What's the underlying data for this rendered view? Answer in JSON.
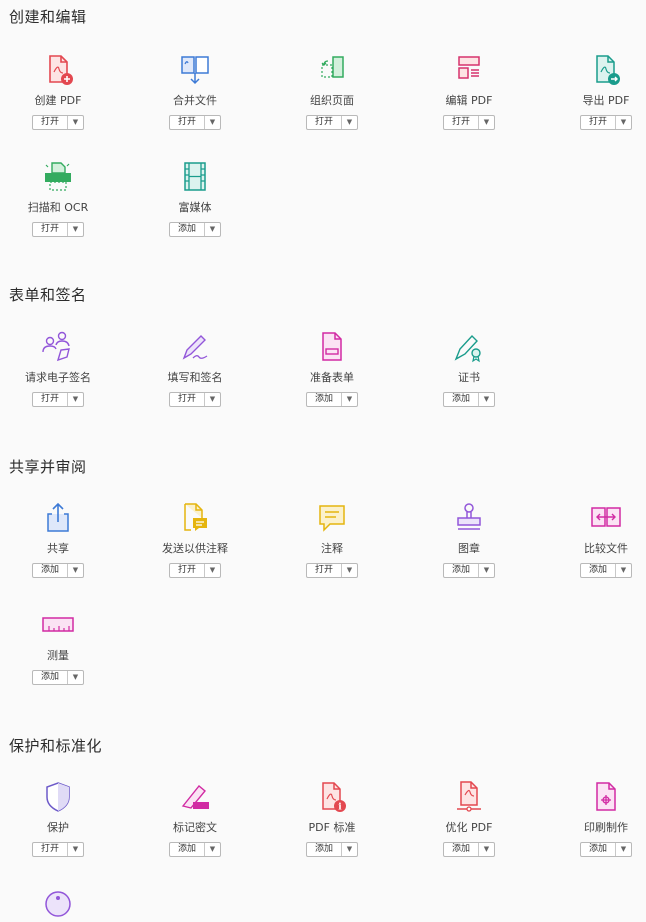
{
  "sections": [
    {
      "title": "创建和编辑",
      "tools": [
        {
          "label": "创建 PDF",
          "button": "打开",
          "icon": "create-pdf-icon"
        },
        {
          "label": "合并文件",
          "button": "打开",
          "icon": "combine-files-icon"
        },
        {
          "label": "组织页面",
          "button": "打开",
          "icon": "organize-pages-icon"
        },
        {
          "label": "编辑 PDF",
          "button": "打开",
          "icon": "edit-pdf-icon"
        },
        {
          "label": "导出 PDF",
          "button": "打开",
          "icon": "export-pdf-icon"
        },
        {
          "label": "扫描和 OCR",
          "button": "打开",
          "icon": "scan-ocr-icon"
        },
        {
          "label": "富媒体",
          "button": "添加",
          "icon": "rich-media-icon"
        }
      ]
    },
    {
      "title": "表单和签名",
      "tools": [
        {
          "label": "请求电子签名",
          "button": "打开",
          "icon": "request-signature-icon"
        },
        {
          "label": "填写和签名",
          "button": "打开",
          "icon": "fill-sign-icon"
        },
        {
          "label": "准备表单",
          "button": "添加",
          "icon": "prepare-form-icon"
        },
        {
          "label": "证书",
          "button": "添加",
          "icon": "certificate-icon"
        }
      ]
    },
    {
      "title": "共享并审阅",
      "tools": [
        {
          "label": "共享",
          "button": "添加",
          "icon": "share-icon"
        },
        {
          "label": "发送以供注释",
          "button": "打开",
          "icon": "send-for-comment-icon"
        },
        {
          "label": "注释",
          "button": "打开",
          "icon": "comment-icon"
        },
        {
          "label": "图章",
          "button": "添加",
          "icon": "stamp-icon"
        },
        {
          "label": "比较文件",
          "button": "添加",
          "icon": "compare-files-icon"
        },
        {
          "label": "测量",
          "button": "添加",
          "icon": "measure-icon"
        }
      ]
    },
    {
      "title": "保护和标准化",
      "tools": [
        {
          "label": "保护",
          "button": "打开",
          "icon": "protect-icon"
        },
        {
          "label": "标记密文",
          "button": "添加",
          "icon": "redact-icon"
        },
        {
          "label": "PDF 标准",
          "button": "添加",
          "icon": "pdf-standards-icon"
        },
        {
          "label": "优化 PDF",
          "button": "添加",
          "icon": "optimize-pdf-icon"
        },
        {
          "label": "印刷制作",
          "button": "添加",
          "icon": "print-production-icon"
        }
      ]
    }
  ],
  "colors": {
    "red": "#e34850",
    "blue": "#3d7ad6",
    "green": "#33ab5f",
    "pink": "#d6336c",
    "teal": "#1a9c8c",
    "purple": "#9256d9",
    "yellow": "#e5b50e",
    "magenta": "#d12ba3"
  }
}
